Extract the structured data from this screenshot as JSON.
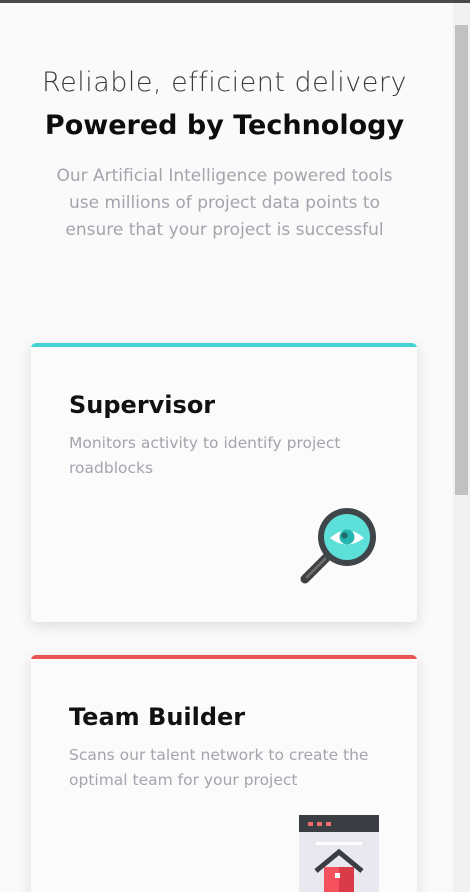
{
  "hero": {
    "subtitle": "Reliable, efficient delivery",
    "title": "Powered by Technology",
    "description": "Our Artificial Intelligence powered tools use millions of project data points to ensure that your project is successful"
  },
  "cards": [
    {
      "title": "Supervisor",
      "description": "Monitors activity to identify project roadblocks",
      "accent_color": "#44d3d2",
      "icon": "magnifier-eye-icon"
    },
    {
      "title": "Team Builder",
      "description": "Scans our talent network to create the optimal team for your project",
      "accent_color": "#ea5454",
      "icon": "team-builder-icon"
    }
  ]
}
